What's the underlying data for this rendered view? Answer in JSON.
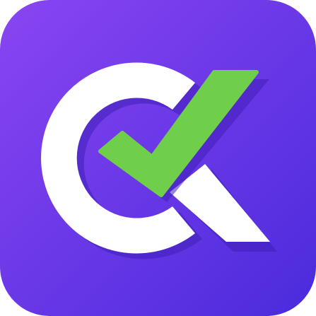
{
  "icon": {
    "name": "checkmark-logo-app-icon",
    "colors": {
      "background_start": "#8a45f2",
      "background_end": "#4a2bdc",
      "letterform": "#ffffff",
      "shadow": "#3f1fb8",
      "checkmark": "#6fcf4b"
    }
  }
}
